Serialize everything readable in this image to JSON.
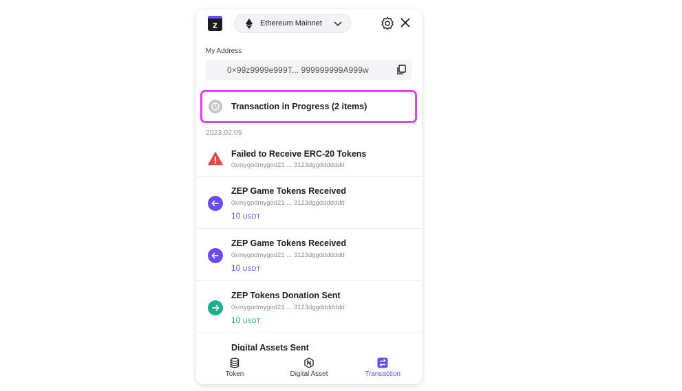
{
  "header": {
    "logo_letter": "z",
    "network": "Ethereum Mainnet",
    "icons": [
      "ethereum-icon",
      "chevron-down-icon",
      "gear-icon",
      "close-icon"
    ]
  },
  "address": {
    "label": "My Address",
    "value": "0×99z9999e999T... 999999999A999w"
  },
  "in_progress": {
    "text": "Transaction in Progress (2 items)"
  },
  "date": "2023.02.09",
  "transactions": [
    {
      "title": "Failed to Receive ERC-20 Tokens",
      "address": "0xmygodmygod21 ... 3123dggddddddd",
      "icon": "warning-icon",
      "color": "#e54848"
    },
    {
      "title": "ZEP Game Tokens Received",
      "address": "0xmygodmygod21 ... 3123dggddddddd",
      "amount": "10",
      "unit": "USDT",
      "icon": "arrow-left-icon",
      "color": "#6a4cf2"
    },
    {
      "title": "ZEP Game Tokens Received",
      "address": "0xmygodmygod21 ... 3123dggddddddd",
      "amount": "10",
      "unit": "USDT",
      "icon": "arrow-left-icon",
      "color": "#6a4cf2"
    },
    {
      "title": "ZEP Tokens Donation Sent",
      "address": "0xmygodmygod21 ... 3123dggddddddd",
      "amount": "10",
      "unit": "USDT",
      "icon": "arrow-right-icon",
      "color": "#1fae8c"
    },
    {
      "title": "Digital Assets Sent"
    }
  ],
  "tabs": [
    {
      "label": "Token",
      "icon": "database-icon"
    },
    {
      "label": "Digital Asset",
      "icon": "nft-hexagon-icon"
    },
    {
      "label": "Transaction",
      "icon": "swap-icon",
      "active": true
    }
  ],
  "colors": {
    "accent": "#6a4cf2",
    "highlight": "#d946ef",
    "success": "#1fae8c",
    "error": "#e54848"
  }
}
